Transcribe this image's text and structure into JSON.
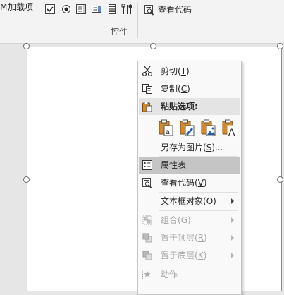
{
  "ribbon": {
    "addin_prefix": "M",
    "addin_label": "加载项",
    "view_code_label": "查看代码",
    "group_label": "控件"
  },
  "menu": {
    "cut": {
      "label": "剪切(",
      "key": "T",
      "close": ")"
    },
    "copy": {
      "label": "复制(",
      "key": "C",
      "close": ")"
    },
    "paste_options": {
      "label": "粘贴选项:"
    },
    "save_as_picture": {
      "label": "另存为图片(",
      "key": "S",
      "close": ")..."
    },
    "property_sheet": {
      "label": "属性表"
    },
    "view_code": {
      "label": "查看代码(",
      "key": "V",
      "close": ")"
    },
    "textbox_object": {
      "label": "文本框对象(",
      "key": "O",
      "close": ")"
    },
    "group": {
      "label": "组合(",
      "key": "G",
      "close": ")"
    },
    "bring_to_front": {
      "label": "置于顶层(",
      "key": "R",
      "close": ")"
    },
    "send_to_back": {
      "label": "置于底层(",
      "key": "K",
      "close": ")"
    },
    "action": {
      "label": "动作"
    }
  },
  "colors": {
    "selected_item": "#c5c5c5",
    "header_bg": "#e4e4e4",
    "disabled_text": "#a6a6a6",
    "accent_blue": "#1f5fa8",
    "paste_orange": "#d48a2c"
  }
}
